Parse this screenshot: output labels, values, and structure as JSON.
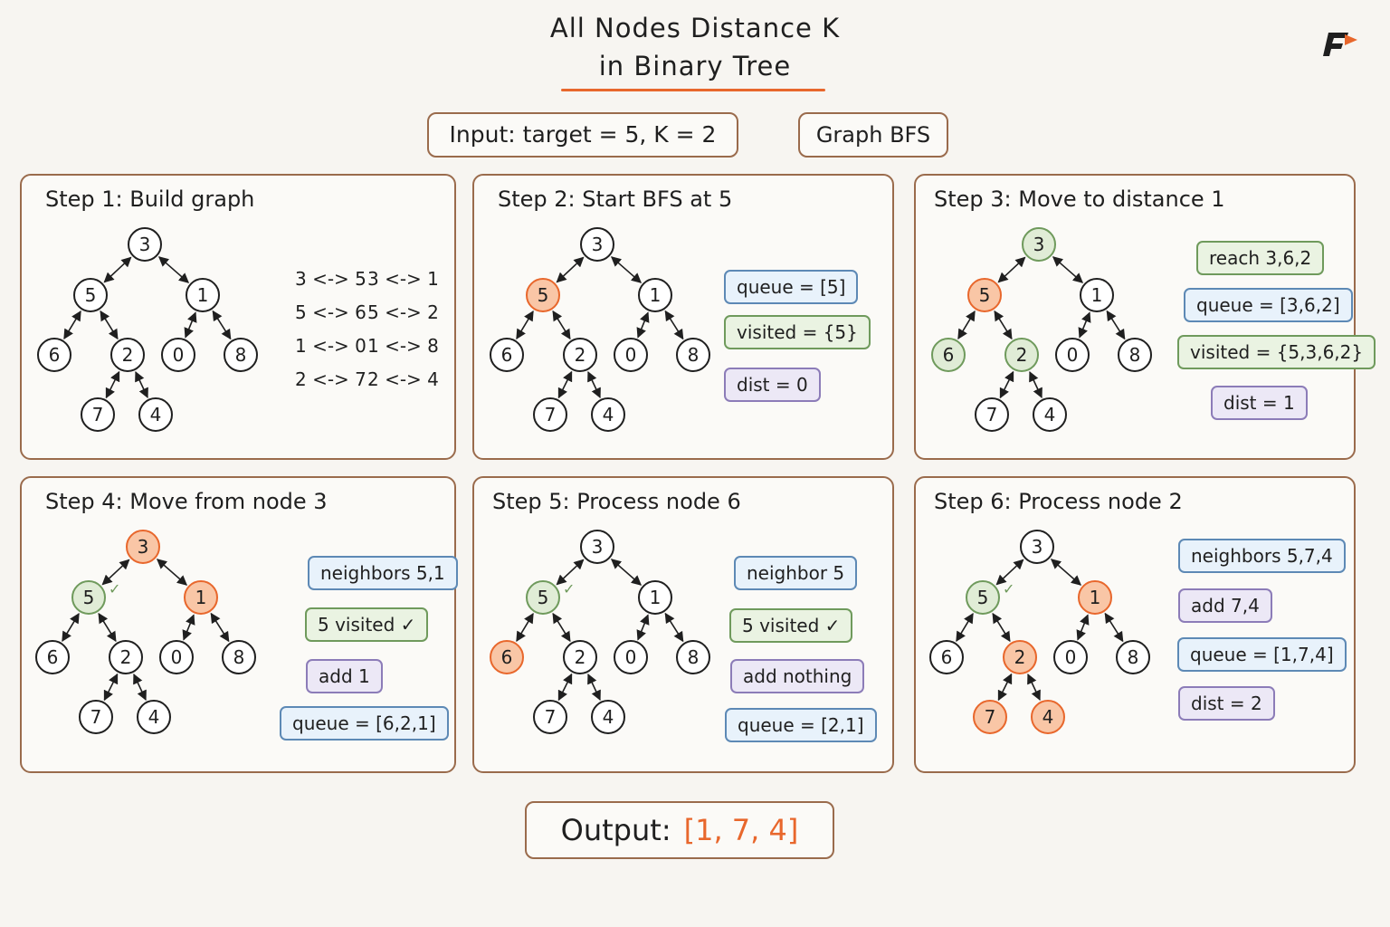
{
  "title": {
    "line1": "All Nodes Distance K",
    "line2": "in Binary Tree"
  },
  "input_label": "Input: target = 5, K = 2",
  "method_label": "Graph BFS",
  "colors": {
    "accent": "#e8672c",
    "visited": "#6f9a5c",
    "border": "#9a6b4c",
    "orange_fill": "#f9c6a6",
    "green_fill": "#e0ecd6"
  },
  "tree": {
    "nodes": [
      "3",
      "5",
      "1",
      "6",
      "2",
      "0",
      "8",
      "7",
      "4"
    ],
    "edges": [
      [
        "3",
        "5"
      ],
      [
        "3",
        "1"
      ],
      [
        "5",
        "6"
      ],
      [
        "5",
        "2"
      ],
      [
        "1",
        "0"
      ],
      [
        "1",
        "8"
      ],
      [
        "2",
        "7"
      ],
      [
        "2",
        "4"
      ]
    ]
  },
  "check_mark": "✓",
  "steps": [
    {
      "title": "Step 1: Build graph",
      "highlight_orange": [],
      "highlight_green": [],
      "checked": [],
      "adjacency": [
        [
          "3 <-> 5",
          "3 <-> 1"
        ],
        [
          "5 <-> 6",
          "5 <-> 2"
        ],
        [
          "1 <-> 0",
          "1 <-> 8"
        ],
        [
          "2 <-> 7",
          "2 <-> 4"
        ]
      ],
      "tags": []
    },
    {
      "title": "Step 2: Start BFS at 5",
      "highlight_orange": [
        "5"
      ],
      "highlight_green": [],
      "checked": [],
      "tags": [
        {
          "text": "queue = [5]",
          "color": "blue"
        },
        {
          "text": "visited = {5}",
          "color": "green"
        },
        {
          "text": "dist = 0",
          "color": "purple"
        }
      ]
    },
    {
      "title": "Step 3: Move to distance 1",
      "highlight_orange": [
        "5"
      ],
      "highlight_green": [
        "3",
        "6",
        "2"
      ],
      "checked": [],
      "tags": [
        {
          "text": "reach 3,6,2",
          "color": "green"
        },
        {
          "text": "queue = [3,6,2]",
          "color": "blue"
        },
        {
          "text": "visited = {5,3,6,2}",
          "color": "green"
        },
        {
          "text": "dist = 1",
          "color": "purple"
        }
      ]
    },
    {
      "title": "Step 4: Move from node 3",
      "highlight_orange": [
        "3",
        "1"
      ],
      "highlight_green": [
        "5"
      ],
      "checked": [
        "5"
      ],
      "tags": [
        {
          "text": "neighbors 5,1",
          "color": "blue"
        },
        {
          "text": "5 visited ✓",
          "color": "green"
        },
        {
          "text": "add 1",
          "color": "purple"
        },
        {
          "text": "queue = [6,2,1]",
          "color": "blue"
        }
      ]
    },
    {
      "title": "Step 5: Process node 6",
      "highlight_orange": [
        "6"
      ],
      "highlight_green": [
        "5"
      ],
      "checked": [
        "5"
      ],
      "tags": [
        {
          "text": "neighbor 5",
          "color": "blue"
        },
        {
          "text": "5 visited ✓",
          "color": "green"
        },
        {
          "text": "add nothing",
          "color": "purple"
        },
        {
          "text": "queue = [2,1]",
          "color": "blue"
        }
      ]
    },
    {
      "title": "Step 6: Process node 2",
      "highlight_orange": [
        "1",
        "2",
        "7",
        "4"
      ],
      "highlight_green": [
        "5"
      ],
      "checked": [
        "5"
      ],
      "tags": [
        {
          "text": "neighbors 5,7,4",
          "color": "blue"
        },
        {
          "text": "add 7,4",
          "color": "purple"
        },
        {
          "text": "queue = [1,7,4]",
          "color": "blue"
        },
        {
          "text": "dist = 2",
          "color": "purple"
        }
      ]
    }
  ],
  "output": {
    "label": "Output:",
    "value": "[1, 7, 4]"
  }
}
